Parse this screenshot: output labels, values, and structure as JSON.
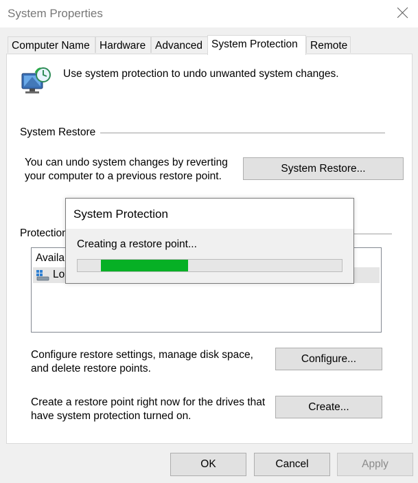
{
  "window": {
    "title": "System Properties"
  },
  "tabs": [
    {
      "label": "Computer Name"
    },
    {
      "label": "Hardware"
    },
    {
      "label": "Advanced"
    },
    {
      "label": "System Protection",
      "active": true
    },
    {
      "label": "Remote"
    }
  ],
  "intro": {
    "text": "Use system protection to undo unwanted system changes.",
    "icon": "system-protection-icon"
  },
  "system_restore": {
    "heading": "System Restore",
    "description_line1": "You can undo system changes by reverting",
    "description_line2": "your computer to a previous restore point.",
    "button_label": "System Restore..."
  },
  "protection_settings": {
    "heading": "Protection",
    "column_header": "Availa",
    "drive_label": "Lo",
    "drive_icon": "drive-icon"
  },
  "configure": {
    "description_line1": "Configure restore settings, manage disk space,",
    "description_line2": "and delete restore points.",
    "button_label": "Configure..."
  },
  "create": {
    "description_line1": "Create a restore point right now for the drives that",
    "description_line2": "have system protection turned on.",
    "button_label": "Create..."
  },
  "footer": {
    "ok_label": "OK",
    "cancel_label": "Cancel",
    "apply_label": "Apply"
  },
  "progress_dialog": {
    "title": "System Protection",
    "message": "Creating a restore point...",
    "indeterminate_fill_fraction": 0.33,
    "fill_color": "#06b025"
  }
}
